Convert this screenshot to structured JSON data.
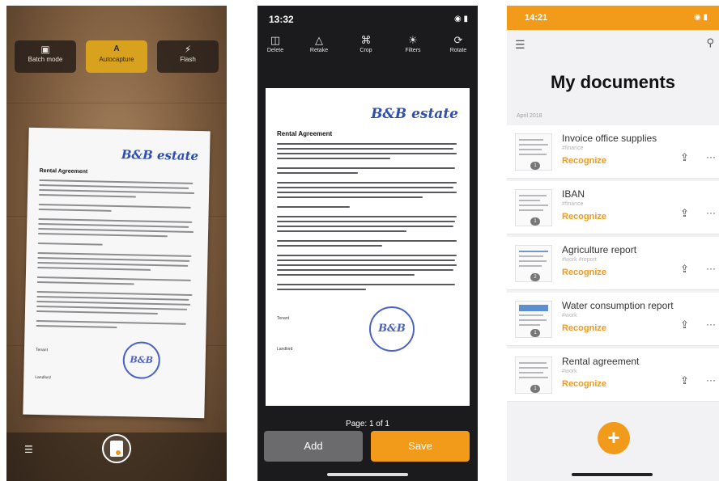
{
  "camera": {
    "modes": [
      {
        "label": "Batch mode",
        "icon": "batch-icon"
      },
      {
        "label": "Autocapture",
        "icon": "autocapture-icon",
        "active": true
      },
      {
        "label": "Flash",
        "icon": "flash-icon"
      }
    ]
  },
  "editor": {
    "time": "13:32",
    "tools": [
      {
        "label": "Delete",
        "icon": "delete-icon"
      },
      {
        "label": "Retake",
        "icon": "retake-icon"
      },
      {
        "label": "Crop",
        "icon": "crop-icon"
      },
      {
        "label": "Filters",
        "icon": "filters-icon"
      },
      {
        "label": "Rotate",
        "icon": "rotate-icon"
      }
    ],
    "page_label": "Page: 1 of 1",
    "add_label": "Add",
    "save_label": "Save"
  },
  "document": {
    "brand": "B&B estate",
    "title": "Rental Agreement",
    "stamp": "B&B",
    "tenant_label": "Tenant",
    "landlord_label": "Landlord"
  },
  "documents_screen": {
    "time": "14:21",
    "title": "My documents",
    "section": "April 2018",
    "items": [
      {
        "name": "Invoice office supplies",
        "tags": "#finance",
        "action": "Recognize",
        "pages": "1"
      },
      {
        "name": "IBAN",
        "tags": "#finance",
        "action": "Recognize",
        "pages": "1"
      },
      {
        "name": "Agriculture report",
        "tags": "#work #report",
        "action": "Recognize",
        "pages": "2"
      },
      {
        "name": "Water consumption report",
        "tags": "#work",
        "action": "Recognize",
        "pages": "1"
      },
      {
        "name": "Rental agreement",
        "tags": "#work",
        "action": "Recognize",
        "pages": "1"
      }
    ],
    "fab_label": "+"
  },
  "colors": {
    "accent": "#f29a1a",
    "autocapture_active": "#d9a21e",
    "brand_blue": "#2f4fae"
  }
}
